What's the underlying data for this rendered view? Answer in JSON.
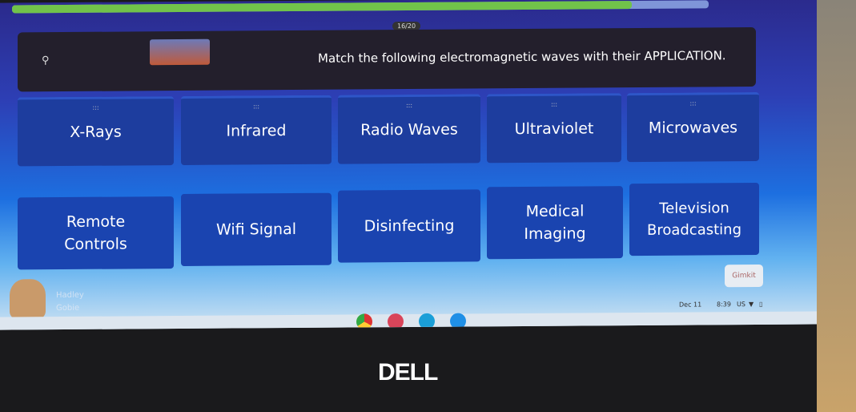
{
  "quiz": {
    "progress_fraction": 0.89,
    "counter": "16/20",
    "question": "Match the following electromagnetic waves with their APPLICATION.",
    "question_icon": "zoom-icon",
    "row1": [
      "X-Rays",
      "Infrared",
      "Radio Waves",
      "Ultraviolet",
      "Microwaves"
    ],
    "row2": [
      "Remote Controls",
      "Wifi Signal",
      "Disinfecting",
      "Medical Imaging",
      "Television Broadcasting"
    ],
    "player": {
      "line1": "Hadley",
      "line2": "Gobie"
    },
    "brand_button": "Gimkit"
  },
  "shelf": {
    "apps": [
      "chrome-icon",
      "app-icon",
      "screencast-icon",
      "files-icon"
    ],
    "date": "Dec 11",
    "time": "8:39",
    "locale": "US"
  },
  "device": {
    "brand": "DELL"
  },
  "colors": {
    "progress": "#71c34a",
    "card": "#1d3d9e",
    "question_bg": "#231f2c"
  }
}
